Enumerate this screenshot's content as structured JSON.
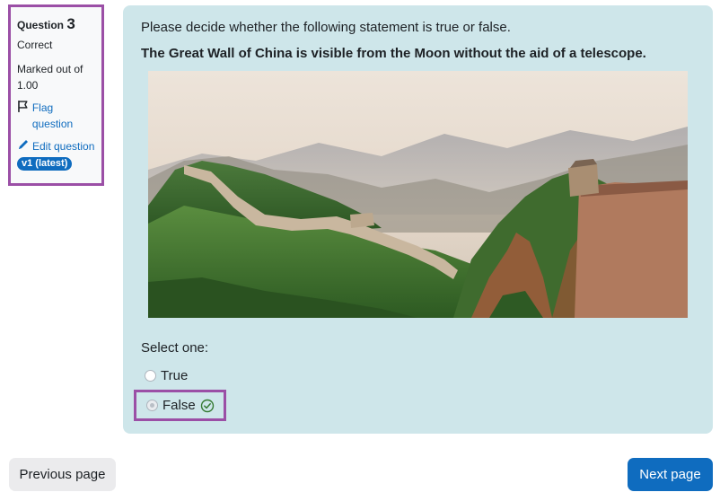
{
  "info": {
    "question_word": "Question",
    "question_number": "3",
    "state": "Correct",
    "marked_out_of": "Marked out of 1.00",
    "flag_label": "Flag question",
    "edit_label": "Edit question",
    "version_badge": "v1 (latest)"
  },
  "question": {
    "prompt": "Please decide whether the following statement is true or false.",
    "statement": "The Great Wall of China is visible from the Moon without the aid of a telescope.",
    "image_description_icon": "great-wall-photo",
    "select_label": "Select one:",
    "options": [
      {
        "label": "True",
        "selected": false
      },
      {
        "label": "False",
        "selected": true,
        "correct": true
      }
    ]
  },
  "navigation": {
    "previous_label": "Previous page",
    "next_label": "Next page"
  },
  "colors": {
    "highlight": "#9b4fa6",
    "accent": "#0f6cbf",
    "content_bg": "#cee6ea",
    "correct": "#357a32"
  }
}
